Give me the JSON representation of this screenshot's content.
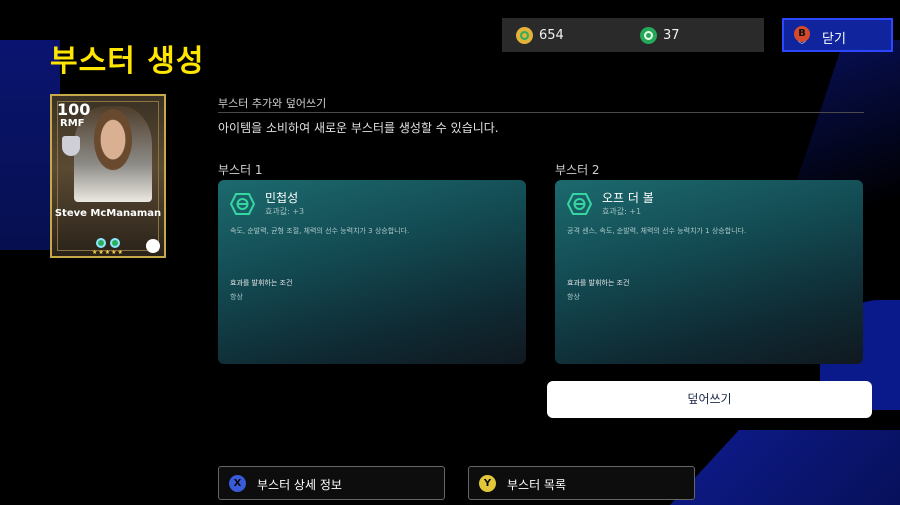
{
  "page": {
    "title": "부스터 생성"
  },
  "currency": [
    {
      "icon": "gold-coin-icon",
      "value": "654"
    },
    {
      "icon": "green-coin-icon",
      "value": "37"
    }
  ],
  "close_button": {
    "badge": "B",
    "label": "닫기"
  },
  "player_card": {
    "rating": "100",
    "position": "RMF",
    "name": "Steve McManaman",
    "stars": "★★★★★"
  },
  "section": {
    "title": "부스터 추가와 덮어쓰기",
    "description": "아이템을 소비하여 새로운 부스터를 생성할 수 있습니다."
  },
  "boosters": [
    {
      "slot_label": "부스터 1",
      "name": "민첩성",
      "effect": "효과값: +3",
      "description": "속도, 순발력, 균형 조절, 체력의 선수 능력치가 3 상승합니다.",
      "condition_label": "효과를 발휘하는 조건",
      "condition_value": "항상"
    },
    {
      "slot_label": "부스터 2",
      "name": "오프 더 볼",
      "effect": "효과값: +1",
      "description": "공격 센스, 속도, 순발력, 체력의 선수 능력치가 1 상승합니다.",
      "condition_label": "효과를 발휘하는 조건",
      "condition_value": "항상"
    }
  ],
  "overwrite_button": {
    "label": "덮어쓰기"
  },
  "footer": [
    {
      "badge": "X",
      "label": "부스터 상세 정보",
      "badge_color": "#3a5bd9"
    },
    {
      "badge": "Y",
      "label": "부스터 목록",
      "badge_color": "#e3c73a"
    }
  ]
}
